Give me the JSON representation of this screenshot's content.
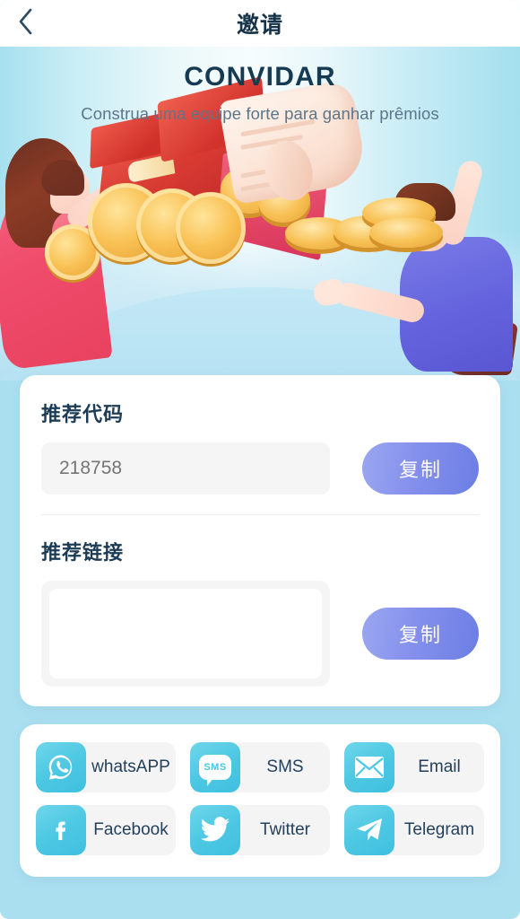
{
  "navbar": {
    "back_icon": "chevron-left-icon",
    "title": "邀请"
  },
  "hero": {
    "title": "CONVIDAR",
    "subtitle": "Construa uma equipe forte para ganhar prêmios",
    "illustration": "invite-friends-gift-coins-illustration"
  },
  "referral": {
    "code_label": "推荐代码",
    "code_value": "218758",
    "code_placeholder": "218758",
    "code_copy_label": "复制",
    "link_label": "推荐链接",
    "link_value": "",
    "link_placeholder": "",
    "link_copy_label": "复制"
  },
  "share": {
    "items": [
      {
        "label": "whatsAPP",
        "icon": "whatsapp-icon"
      },
      {
        "label": "SMS",
        "icon": "sms-icon"
      },
      {
        "label": "Email",
        "icon": "email-icon"
      },
      {
        "label": "Facebook",
        "icon": "facebook-icon"
      },
      {
        "label": "Twitter",
        "icon": "twitter-icon"
      },
      {
        "label": "Telegram",
        "icon": "telegram-icon"
      }
    ],
    "sms_glyph": "SMS"
  },
  "colors": {
    "page_background": "#aadff0",
    "nav_background": "#ffffff",
    "title_text": "#163a52",
    "subtitle_text": "#5c7689",
    "copy_button_start": "#9ba7f0",
    "copy_button_end": "#6c7ee4",
    "share_icon_start": "#6fd6ea",
    "share_icon_end": "#3fc0df",
    "input_background": "#f5f5f6",
    "card_background": "#ffffff"
  }
}
